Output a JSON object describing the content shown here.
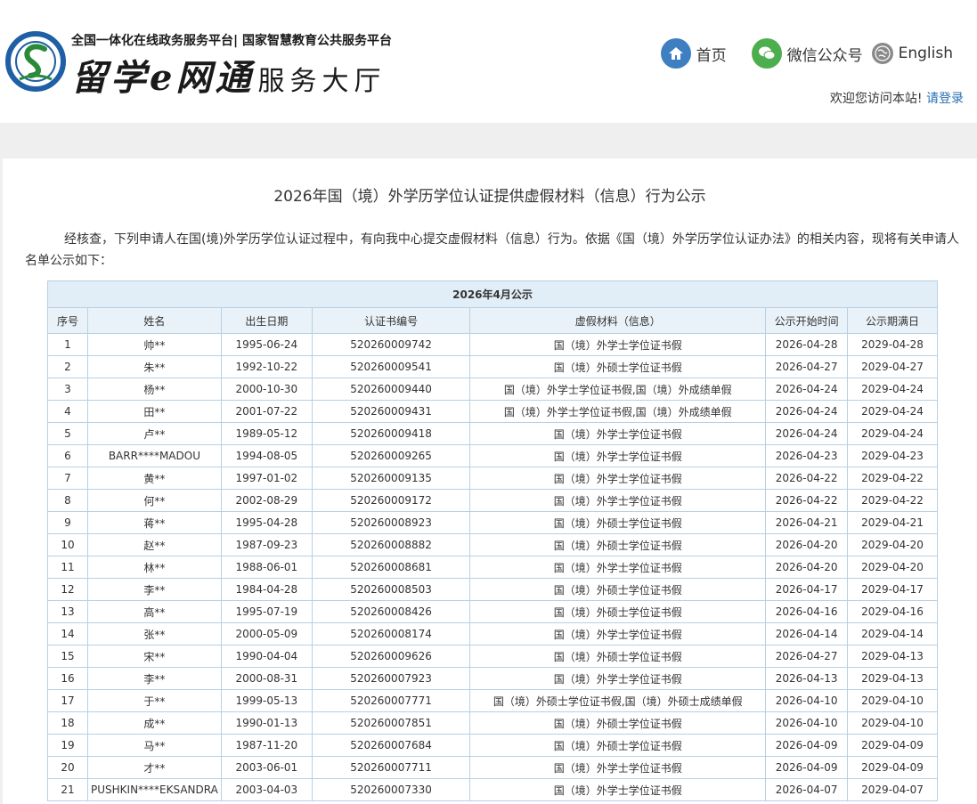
{
  "header": {
    "subtitle": "全国一体化在线政务服务平台| 国家智慧教育公共服务平台",
    "brand": "留学e网通",
    "hall": "服务大厅",
    "logo_icon": "cscse-logo-icon"
  },
  "nav": {
    "home": "首页",
    "wechat": "微信公众号",
    "english": "English",
    "welcome": "欢迎您访问本站!",
    "login": "请登录"
  },
  "notice": {
    "title": "2026年国（境）外学历学位认证提供虚假材料（信息）行为公示",
    "intro": "经核查，下列申请人在国(境)外学历学位认证过程中，有向我中心提交虚假材料（信息）行为。依据《国（境）外学历学位认证办法》的相关内容，现将有关申请人名单公示如下："
  },
  "table": {
    "caption": "2026年4月公示",
    "columns": [
      "序号",
      "姓名",
      "出生日期",
      "认证书编号",
      "虚假材料（信息）",
      "公示开始时间",
      "公示期满日"
    ],
    "rows": [
      [
        "1",
        "帅**",
        "1995-06-24",
        "520260009742",
        "国（境）外学士学位证书假",
        "2026-04-28",
        "2029-04-28"
      ],
      [
        "2",
        "朱**",
        "1992-10-22",
        "520260009541",
        "国（境）外硕士学位证书假",
        "2026-04-27",
        "2029-04-27"
      ],
      [
        "3",
        "杨**",
        "2000-10-30",
        "520260009440",
        "国（境）外学士学位证书假,国（境）外成绩单假",
        "2026-04-24",
        "2029-04-24"
      ],
      [
        "4",
        "田**",
        "2001-07-22",
        "520260009431",
        "国（境）外学士学位证书假,国（境）外成绩单假",
        "2026-04-24",
        "2029-04-24"
      ],
      [
        "5",
        "卢**",
        "1989-05-12",
        "520260009418",
        "国（境）外学士学位证书假",
        "2026-04-24",
        "2029-04-24"
      ],
      [
        "6",
        "BARR****MADOU",
        "1994-08-05",
        "520260009265",
        "国（境）外学士学位证书假",
        "2026-04-23",
        "2029-04-23"
      ],
      [
        "7",
        "黄**",
        "1997-01-02",
        "520260009135",
        "国（境）外学士学位证书假",
        "2026-04-22",
        "2029-04-22"
      ],
      [
        "8",
        "何**",
        "2002-08-29",
        "520260009172",
        "国（境）外学士学位证书假",
        "2026-04-22",
        "2029-04-22"
      ],
      [
        "9",
        "蒋**",
        "1995-04-28",
        "520260008923",
        "国（境）外硕士学位证书假",
        "2026-04-21",
        "2029-04-21"
      ],
      [
        "10",
        "赵**",
        "1987-09-23",
        "520260008882",
        "国（境）外硕士学位证书假",
        "2026-04-20",
        "2029-04-20"
      ],
      [
        "11",
        "林**",
        "1988-06-01",
        "520260008681",
        "国（境）外学士学位证书假",
        "2026-04-20",
        "2029-04-20"
      ],
      [
        "12",
        "李**",
        "1984-04-28",
        "520260008503",
        "国（境）外硕士学位证书假",
        "2026-04-17",
        "2029-04-17"
      ],
      [
        "13",
        "高**",
        "1995-07-19",
        "520260008426",
        "国（境）外硕士学位证书假",
        "2026-04-16",
        "2029-04-16"
      ],
      [
        "14",
        "张**",
        "2000-05-09",
        "520260008174",
        "国（境）外学士学位证书假",
        "2026-04-14",
        "2029-04-14"
      ],
      [
        "15",
        "宋**",
        "1990-04-04",
        "520260009626",
        "国（境）外硕士学位证书假",
        "2026-04-27",
        "2029-04-13"
      ],
      [
        "16",
        "李**",
        "2000-08-31",
        "520260007923",
        "国（境）外学士学位证书假",
        "2026-04-13",
        "2029-04-13"
      ],
      [
        "17",
        "于**",
        "1999-05-13",
        "520260007771",
        "国（境）外硕士学位证书假,国（境）外硕士成绩单假",
        "2026-04-10",
        "2029-04-10"
      ],
      [
        "18",
        "成**",
        "1990-01-13",
        "520260007851",
        "国（境）外硕士学位证书假",
        "2026-04-10",
        "2029-04-10"
      ],
      [
        "19",
        "马**",
        "1987-11-20",
        "520260007684",
        "国（境）外硕士学位证书假",
        "2026-04-09",
        "2029-04-09"
      ],
      [
        "20",
        "才**",
        "2003-06-01",
        "520260007711",
        "国（境）外学士学位证书假",
        "2026-04-09",
        "2029-04-09"
      ],
      [
        "21",
        "PUSHKIN****EKSANDRA",
        "2003-04-03",
        "520260007330",
        "国（境）外学士学位证书假",
        "2026-04-07",
        "2029-04-07"
      ]
    ]
  }
}
